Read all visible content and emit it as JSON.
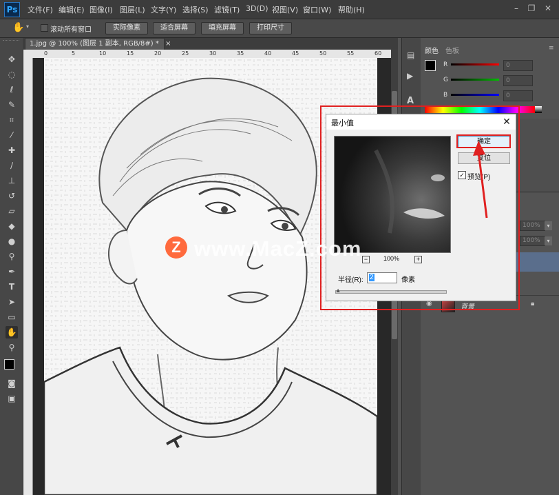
{
  "app": {
    "logo": "Ps"
  },
  "menu": [
    "文件(F)",
    "编辑(E)",
    "图像(I)",
    "图层(L)",
    "文字(Y)",
    "选择(S)",
    "滤镜(T)",
    "3D(D)",
    "视图(V)",
    "窗口(W)",
    "帮助(H)"
  ],
  "window_controls": {
    "minimize": "–",
    "restore": "❐",
    "close": "✕"
  },
  "options_bar": {
    "scroll_all_label": "滚动所有窗口",
    "actual_pixels": "实际像素",
    "fit_screen": "适合屏幕",
    "fill_screen": "填充屏幕",
    "print_size": "打印尺寸"
  },
  "document_tab": {
    "title": "1.jpg @ 100% (图层 1 副本, RGB/8#) *",
    "close": "×"
  },
  "ruler_ticks": [
    "0",
    "5",
    "10",
    "15",
    "20",
    "25",
    "30",
    "35",
    "40",
    "45",
    "50",
    "55",
    "60"
  ],
  "color_panel": {
    "tabs": [
      "颜色",
      "色板"
    ],
    "channels": [
      {
        "label": "R",
        "value": "0",
        "gradient": "#ff0000"
      },
      {
        "label": "G",
        "value": "0",
        "gradient": "#00c000"
      },
      {
        "label": "B",
        "value": "0",
        "gradient": "#0000ff"
      }
    ]
  },
  "layers_panel": {
    "opacity_value": "100%",
    "fill_value": "100%",
    "background_layer_name": "背景"
  },
  "dialog": {
    "title": "最小值",
    "close": "✕",
    "ok_label": "确定",
    "reset_label": "复位",
    "preview_label": "预览(P)",
    "preview_checked": true,
    "zoom_level": "100%",
    "zoom_out": "−",
    "zoom_in": "+",
    "radius_label": "半径(R):",
    "radius_value": "2",
    "radius_unit": "像素",
    "radius_slider_fraction": 0.01
  },
  "watermark": {
    "badge": "Z",
    "text": "www.MacZ.com"
  },
  "colors": {
    "highlight_red": "#e02020",
    "ps_blue": "#31a8ff"
  },
  "tools": [
    "move-icon",
    "marquee-icon",
    "lasso-icon",
    "quick-select-icon",
    "crop-icon",
    "eyedropper-icon",
    "healing-icon",
    "brush-icon",
    "stamp-icon",
    "history-brush-icon",
    "eraser-icon",
    "gradient-icon",
    "blur-icon",
    "dodge-icon",
    "pen-icon",
    "type-icon",
    "path-select-icon",
    "rectangle-icon",
    "hand-icon",
    "zoom-icon"
  ]
}
